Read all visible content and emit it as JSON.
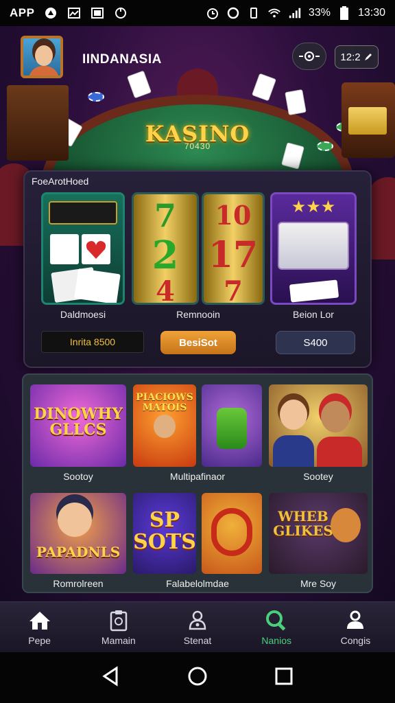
{
  "status_bar": {
    "app_label": "APP",
    "battery": "33%",
    "time": "13:30"
  },
  "header": {
    "title": "IINDANASIA",
    "timer_label": "12:2"
  },
  "scene": {
    "table_title": "KASINO",
    "table_subtitle": "70430"
  },
  "featured": {
    "title": "FoeArotHoed",
    "slots": [
      {
        "label": "Daldmoesi"
      },
      {
        "label": "Remnooin",
        "reels": [
          "7",
          "2",
          "4"
        ]
      },
      {
        "reels": [
          "10",
          "17",
          "7"
        ]
      },
      {
        "label": "Beion Lor"
      }
    ],
    "amount_label": "Inrita 8500",
    "reset_label": "BesiSot",
    "amount_button": "S400"
  },
  "games": [
    {
      "label": "Sootoy",
      "art_text": "DINOWHY GLLCS"
    },
    {
      "label": "Multipafinaor",
      "art_text": "PIACIOWS MATOIS"
    },
    {
      "label": "Sootey"
    },
    {
      "label": "Romrolreen",
      "art_text": "PAPADNLS"
    },
    {
      "label": "Falabelolmdae",
      "art_text": "SP SOTS"
    },
    {
      "label": "Mre Soy",
      "art_text": "WHEB GLIKES"
    }
  ],
  "bottom_nav": [
    {
      "label": "Pepe",
      "icon": "home-icon"
    },
    {
      "label": "Mamain",
      "icon": "document-icon"
    },
    {
      "label": "Stenat",
      "icon": "bell-icon"
    },
    {
      "label": "Nanios",
      "icon": "search-icon",
      "active": true
    },
    {
      "label": "Congis",
      "icon": "person-icon"
    }
  ],
  "colors": {
    "accent_gold": "#ffd34a",
    "active_nav": "#4ad07a",
    "reset_orange": "#e08c28"
  }
}
